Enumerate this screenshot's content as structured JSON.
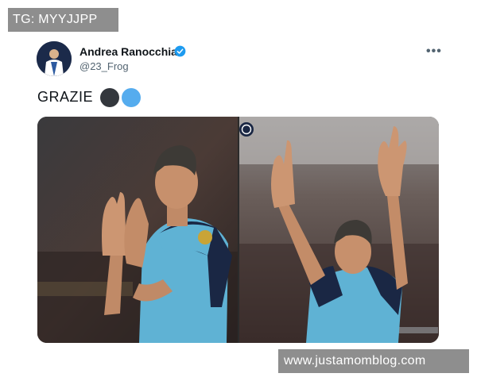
{
  "watermarks": {
    "top": "TG: MYYJJPP",
    "bottom": "www.justamomblog.com"
  },
  "tweet": {
    "author_name": "Andrea Ranocchia",
    "author_handle": "@23_Frog",
    "text": "GRAZIE",
    "heart_colors": [
      "#33373d",
      "#55acee"
    ],
    "verified_color": "#1d9bf0",
    "icons": {
      "verified": "verified-badge-icon",
      "more": "more-options-icon"
    }
  },
  "colors": {
    "jersey": "#5fb2d4",
    "kit_dark": "#1a2744",
    "watermark_bg": "#8e8e8e"
  }
}
